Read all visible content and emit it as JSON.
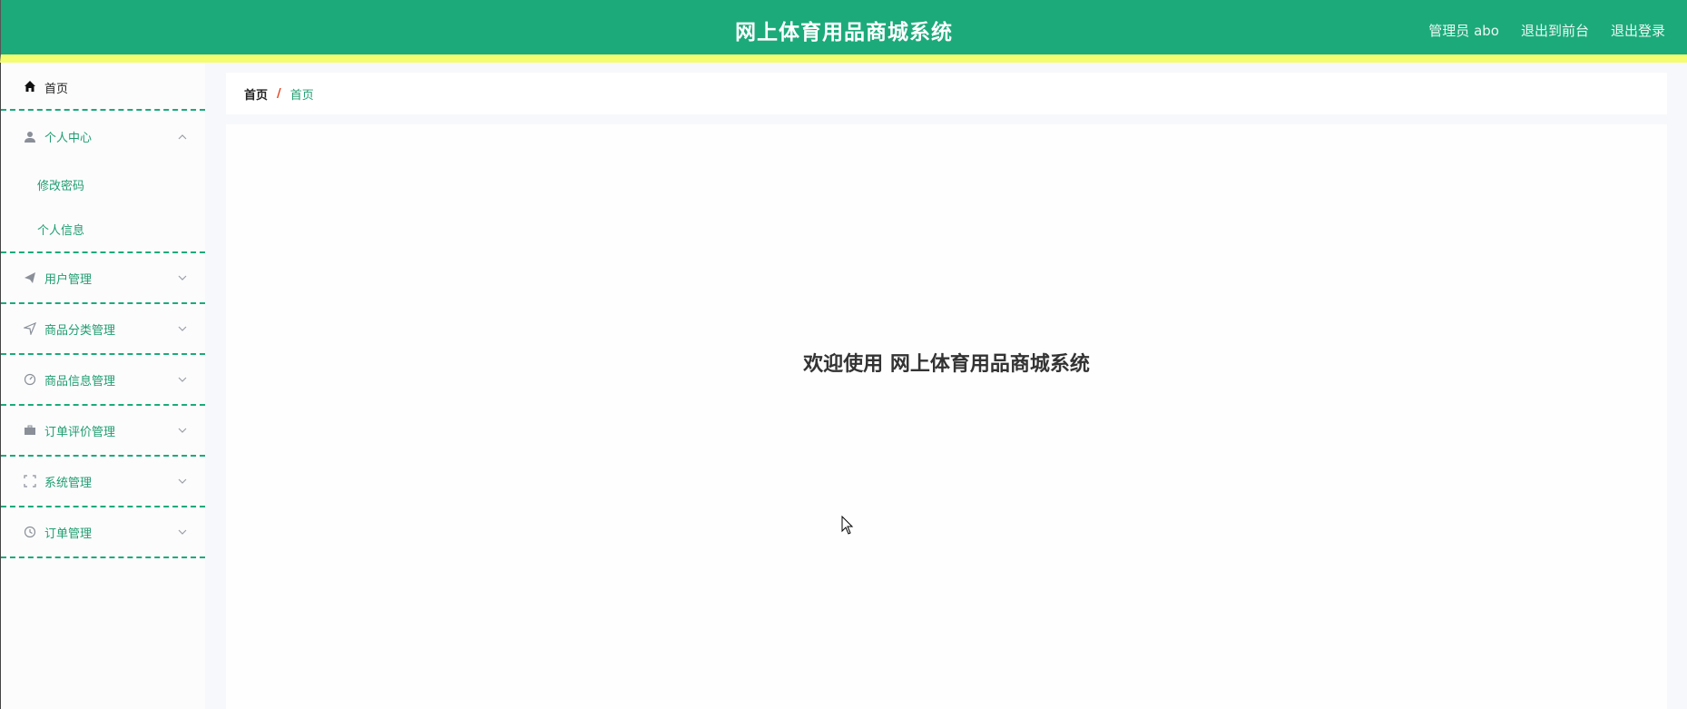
{
  "header": {
    "title": "网上体育用品商城系统",
    "user_label": "管理员 abo",
    "front_link": "退出到前台",
    "logout_link": "退出登录"
  },
  "sidebar": {
    "home": "首页",
    "personal": {
      "label": "个人中心",
      "children": [
        "修改密码",
        "个人信息"
      ]
    },
    "items": [
      {
        "label": "用户管理",
        "icon": "send-icon"
      },
      {
        "label": "商品分类管理",
        "icon": "navigation-icon"
      },
      {
        "label": "商品信息管理",
        "icon": "gauge-icon"
      },
      {
        "label": "订单评价管理",
        "icon": "briefcase-icon"
      },
      {
        "label": "系统管理",
        "icon": "fullscreen-icon"
      },
      {
        "label": "订单管理",
        "icon": "clock-icon"
      }
    ]
  },
  "breadcrumb": {
    "home": "首页",
    "separator": "/",
    "current": "首页"
  },
  "main": {
    "welcome": "欢迎使用 网上体育用品商城系统"
  },
  "colors": {
    "primary": "#1caa7b",
    "accent_strip": "#f4fd6f",
    "separator": "#e0401c"
  }
}
